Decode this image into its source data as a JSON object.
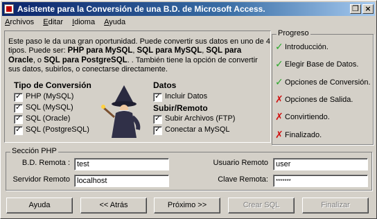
{
  "window": {
    "title": "Asistente para la Conversión de una B.D. de Microsoft Access."
  },
  "menu": [
    "Archivos",
    "Editar",
    "Idioma",
    "Ayuda"
  ],
  "description": {
    "p1": "Este paso le da una gran oportunidad. Puede convertir sus datos en uno de 4 tipos. Puede ser: ",
    "s1": "PHP para MySQL",
    "p2": ", ",
    "s2": "SQL para MySQL",
    "p3": ", ",
    "s3": "SQL para Oracle",
    "p4": ", o ",
    "s4": "SQL para PostgreSQL",
    "p5": ". . También tiene la opción de convertir sus datos, subirlos, o conectarse directamente."
  },
  "conversion": {
    "title": "Tipo de Conversión",
    "options": [
      "PHP (MySQL)",
      "SQL (MySQL)",
      "SQL (Oracle)",
      "SQL (PostgreSQL)"
    ]
  },
  "data": {
    "title": "Datos",
    "include_label": "Incluir Datos"
  },
  "upload": {
    "title": "Subir/Remoto",
    "options": [
      "Subir Archivos (FTP)",
      "Conectar a MySQL"
    ]
  },
  "progress": {
    "title": "Progreso",
    "steps": [
      {
        "label": "Introducción.",
        "status": "done"
      },
      {
        "label": "Elegir Base de Datos.",
        "status": "done"
      },
      {
        "label": "Opciones de Conversión.",
        "status": "done"
      },
      {
        "label": "Opciones de Salida.",
        "status": "pending"
      },
      {
        "label": "Convirtiendo.",
        "status": "pending"
      },
      {
        "label": "Finalizado.",
        "status": "pending"
      }
    ]
  },
  "php_section": {
    "title": "Sección PHP",
    "remote_db_label": "B.D. Remota :",
    "remote_db_value": "test",
    "remote_server_label": "Servidor Remoto",
    "remote_server_value": "localhost",
    "remote_user_label": "Usuario Remoto",
    "remote_user_value": "user",
    "remote_password_label": "Clave Remota:",
    "remote_password_value": "*******"
  },
  "buttons": {
    "help": "Ayuda",
    "back": "<< Atrás",
    "next": "Próximo >>",
    "create_sql": "Crear SQL",
    "finish": "Finalizar"
  }
}
